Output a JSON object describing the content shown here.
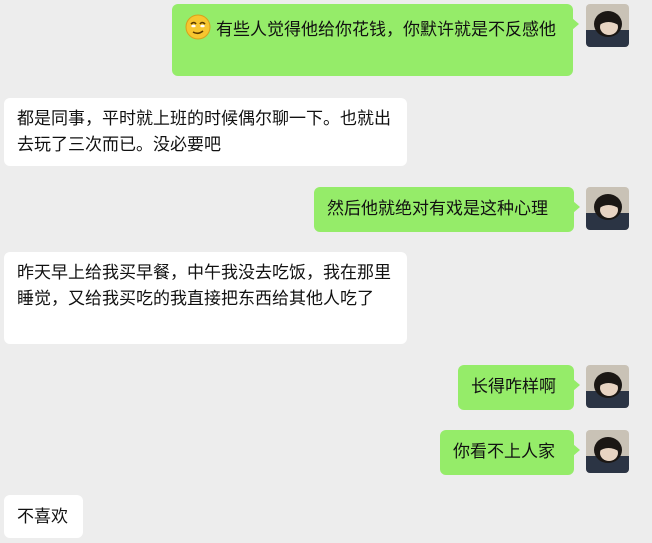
{
  "chat": {
    "messages": [
      {
        "side": "out",
        "text": "有些人觉得他给你花钱，你默许就是不反感他",
        "emoji": "smirk-emoji"
      },
      {
        "side": "in",
        "text": "都是同事，平时就上班的时候偶尔聊一下。也就出去玩了三次而已。没必要吧"
      },
      {
        "side": "out",
        "text": "然后他就绝对有戏是这种心理"
      },
      {
        "side": "in",
        "text": "昨天早上给我买早餐，中午我没去吃饭，我在那里睡觉，又给我买吃的我直接把东西给其他人吃了"
      },
      {
        "side": "out",
        "text": "长得咋样啊"
      },
      {
        "side": "out",
        "text": "你看不上人家"
      },
      {
        "side": "in",
        "text": "不喜欢"
      }
    ]
  },
  "colors": {
    "background": "#ededed",
    "outgoing_bubble": "#95ec69",
    "incoming_bubble": "#ffffff"
  },
  "icons": {
    "user_avatar": "avatar-girl-icon"
  }
}
